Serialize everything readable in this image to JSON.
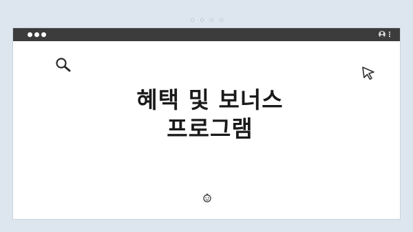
{
  "pager": {
    "dot_count": 4
  },
  "window": {
    "titlebar": {
      "dot_count": 3,
      "icons": [
        "user-icon",
        "kebab-menu-icon"
      ]
    },
    "content": {
      "title_line_1": "혜택 및 보너스",
      "title_line_2": "프로그램",
      "icons": [
        "search-icon",
        "cursor-icon",
        "smile-icon"
      ]
    }
  },
  "colors": {
    "background": "#dde5ee",
    "titlebar": "#3c3c3c",
    "window": "#ffffff",
    "text": "#1a1a1a"
  }
}
